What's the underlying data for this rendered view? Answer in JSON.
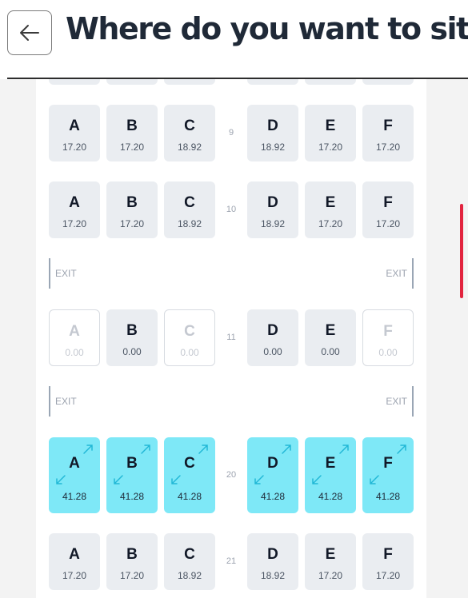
{
  "header": {
    "title": "Where do you want to sit?",
    "back_icon": "arrow-left-icon"
  },
  "colors": {
    "standard_seat": "#eaedf1",
    "extra_legroom_seat": "#7ee8f7",
    "scrollbar": "#e2243f"
  },
  "rows": [
    {
      "number": "9",
      "seats": [
        {
          "letter": "A",
          "price": "17.20",
          "state": "available"
        },
        {
          "letter": "B",
          "price": "17.20",
          "state": "available"
        },
        {
          "letter": "C",
          "price": "18.92",
          "state": "available"
        },
        {
          "letter": "D",
          "price": "18.92",
          "state": "available"
        },
        {
          "letter": "E",
          "price": "17.20",
          "state": "available"
        },
        {
          "letter": "F",
          "price": "17.20",
          "state": "available"
        }
      ]
    },
    {
      "number": "10",
      "seats": [
        {
          "letter": "A",
          "price": "17.20",
          "state": "available"
        },
        {
          "letter": "B",
          "price": "17.20",
          "state": "available"
        },
        {
          "letter": "C",
          "price": "18.92",
          "state": "available"
        },
        {
          "letter": "D",
          "price": "18.92",
          "state": "available"
        },
        {
          "letter": "E",
          "price": "17.20",
          "state": "available"
        },
        {
          "letter": "F",
          "price": "17.20",
          "state": "available"
        }
      ]
    },
    {
      "number": "11",
      "seats": [
        {
          "letter": "A",
          "price": "0.00",
          "state": "unavailable"
        },
        {
          "letter": "B",
          "price": "0.00",
          "state": "available"
        },
        {
          "letter": "C",
          "price": "0.00",
          "state": "unavailable"
        },
        {
          "letter": "D",
          "price": "0.00",
          "state": "available"
        },
        {
          "letter": "E",
          "price": "0.00",
          "state": "available"
        },
        {
          "letter": "F",
          "price": "0.00",
          "state": "unavailable"
        }
      ]
    },
    {
      "number": "20",
      "seats": [
        {
          "letter": "A",
          "price": "41.28",
          "state": "extra-legroom"
        },
        {
          "letter": "B",
          "price": "41.28",
          "state": "extra-legroom"
        },
        {
          "letter": "C",
          "price": "41.28",
          "state": "extra-legroom"
        },
        {
          "letter": "D",
          "price": "41.28",
          "state": "extra-legroom"
        },
        {
          "letter": "E",
          "price": "41.28",
          "state": "extra-legroom"
        },
        {
          "letter": "F",
          "price": "41.28",
          "state": "extra-legroom"
        }
      ]
    },
    {
      "number": "21",
      "seats": [
        {
          "letter": "A",
          "price": "17.20",
          "state": "available"
        },
        {
          "letter": "B",
          "price": "17.20",
          "state": "available"
        },
        {
          "letter": "C",
          "price": "18.92",
          "state": "available"
        },
        {
          "letter": "D",
          "price": "18.92",
          "state": "available"
        },
        {
          "letter": "E",
          "price": "17.20",
          "state": "available"
        },
        {
          "letter": "F",
          "price": "17.20",
          "state": "available"
        }
      ]
    }
  ],
  "exits": {
    "left_label": "EXIT",
    "right_label": "EXIT"
  }
}
